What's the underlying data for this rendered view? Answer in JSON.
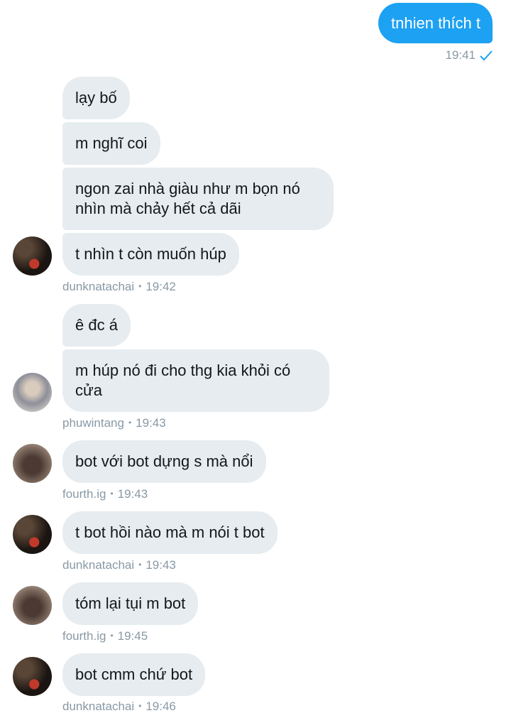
{
  "outgoing": {
    "text": "tnhien thích t",
    "time": "19:41"
  },
  "incoming": [
    {
      "text": "lạy bố"
    },
    {
      "text": "m nghĩ coi"
    },
    {
      "text": "ngon zai nhà giàu như m bọn nó nhìn mà chảy hết cả dãi"
    },
    {
      "text": "t nhìn t còn muốn húp"
    },
    {
      "text": "ê đc á"
    },
    {
      "text": "m húp nó đi cho thg kia khỏi có cửa"
    },
    {
      "text": "bot với bot dựng s mà nổi"
    },
    {
      "text": "t bot hồi nào mà m nói t bot"
    },
    {
      "text": "tóm lại tụi m bot"
    },
    {
      "text": "bot cmm chứ bot"
    }
  ],
  "meta": [
    {
      "user": "dunknatachai",
      "time": "19:42"
    },
    {
      "user": "phuwintang",
      "time": "19:43"
    },
    {
      "user": "fourth.ig",
      "time": "19:43"
    },
    {
      "user": "dunknatachai",
      "time": "19:43"
    },
    {
      "user": "fourth.ig",
      "time": "19:45"
    },
    {
      "user": "dunknatachai",
      "time": "19:46"
    }
  ],
  "separator": "•",
  "colors": {
    "outgoing_bubble": "#1da1f2",
    "incoming_bubble": "#e6ecf0",
    "meta_text": "#8899a6"
  },
  "icons": {
    "read_receipt": "checkmark-icon"
  }
}
